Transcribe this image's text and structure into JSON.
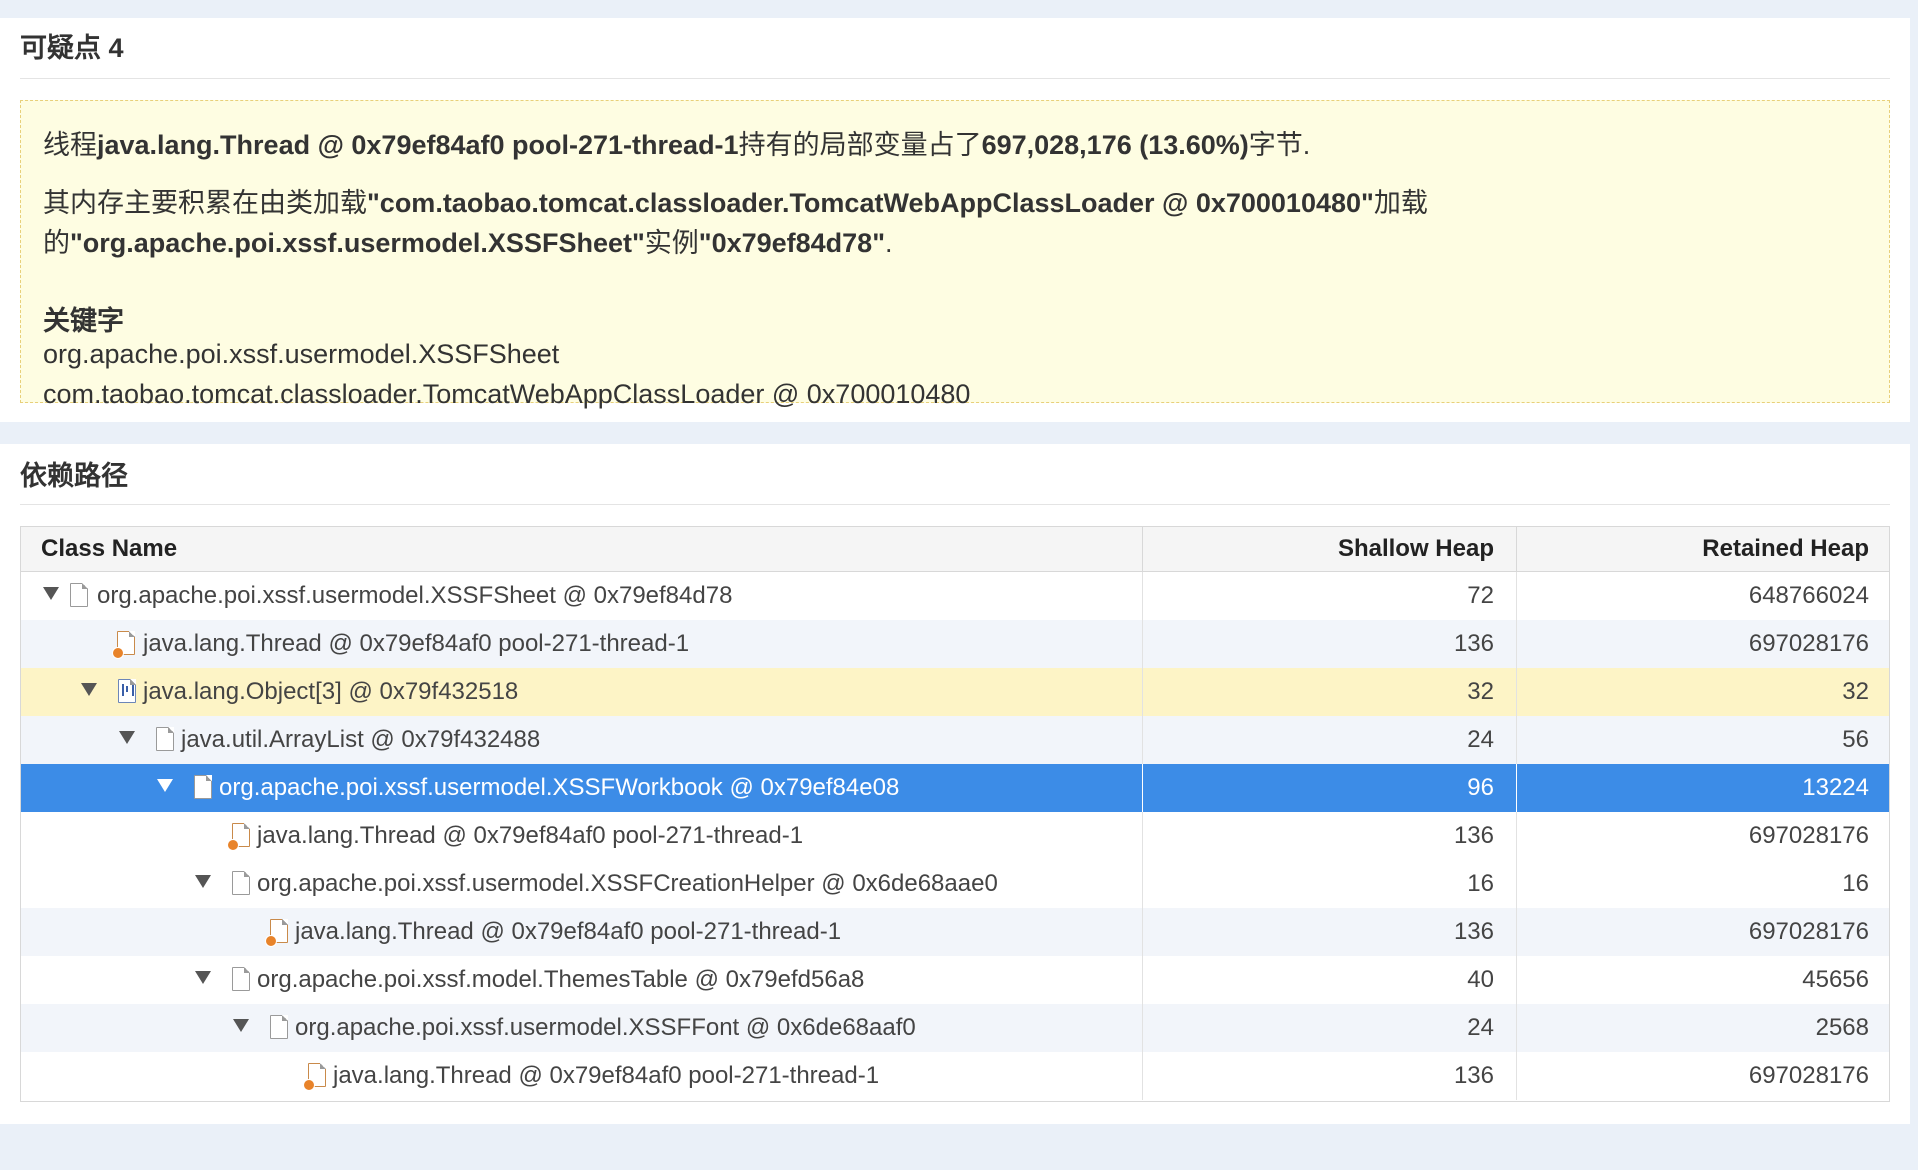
{
  "suspect": {
    "title": "可疑点 4",
    "line1_prefix": "线程",
    "line1_thread": "java.lang.Thread @ 0x79ef84af0 pool-271-thread-1",
    "line1_mid": "持有的局部变量占了",
    "line1_bytes": "697,028,176 (13.60%)",
    "line1_suffix": "字节.",
    "line2_prefix": "其内存主要积累在由类加载",
    "line2_loader": "\"com.taobao.tomcat.classloader.TomcatWebAppClassLoader @ 0x700010480\"",
    "line2_mid": "加载",
    "line3_prefix": "的",
    "line3_class": "\"org.apache.poi.xssf.usermodel.XSSFSheet\"",
    "line3_mid": "实例",
    "line3_instance": "\"0x79ef84d78\"",
    "line3_suffix": ".",
    "keywords_label": "关键字",
    "keyword1": "org.apache.poi.xssf.usermodel.XSSFSheet",
    "keyword2": "com.taobao.tomcat.classloader.TomcatWebAppClassLoader @ 0x700010480"
  },
  "path": {
    "title": "依赖路径",
    "columns": {
      "name": "Class Name",
      "shallow": "Shallow Heap",
      "retained": "Retained Heap"
    },
    "rows": [
      {
        "name": "org.apache.poi.xssf.usermodel.XSSFSheet @ 0x79ef84d78",
        "shallow": "72",
        "retained": "648766024"
      },
      {
        "name": "java.lang.Thread @ 0x79ef84af0 pool-271-thread-1",
        "shallow": "136",
        "retained": "697028176"
      },
      {
        "name": "java.lang.Object[3] @ 0x79f432518",
        "shallow": "32",
        "retained": "32"
      },
      {
        "name": "java.util.ArrayList @ 0x79f432488",
        "shallow": "24",
        "retained": "56"
      },
      {
        "name": "org.apache.poi.xssf.usermodel.XSSFWorkbook @ 0x79ef84e08",
        "shallow": "96",
        "retained": "13224"
      },
      {
        "name": "java.lang.Thread @ 0x79ef84af0 pool-271-thread-1",
        "shallow": "136",
        "retained": "697028176"
      },
      {
        "name": "org.apache.poi.xssf.usermodel.XSSFCreationHelper @ 0x6de68aae0",
        "shallow": "16",
        "retained": "16"
      },
      {
        "name": "java.lang.Thread @ 0x79ef84af0 pool-271-thread-1",
        "shallow": "136",
        "retained": "697028176"
      },
      {
        "name": "org.apache.poi.xssf.model.ThemesTable @ 0x79efd56a8",
        "shallow": "40",
        "retained": "45656"
      },
      {
        "name": "org.apache.poi.xssf.usermodel.XSSFFont @ 0x6de68aaf0",
        "shallow": "24",
        "retained": "2568"
      },
      {
        "name": "java.lang.Thread @ 0x79ef84af0 pool-271-thread-1",
        "shallow": "136",
        "retained": "697028176"
      }
    ]
  },
  "colors": {
    "selected_row": "#3c8ce7",
    "highlight_row": "#fdf4c6",
    "suspect_box": "#fefde2"
  }
}
